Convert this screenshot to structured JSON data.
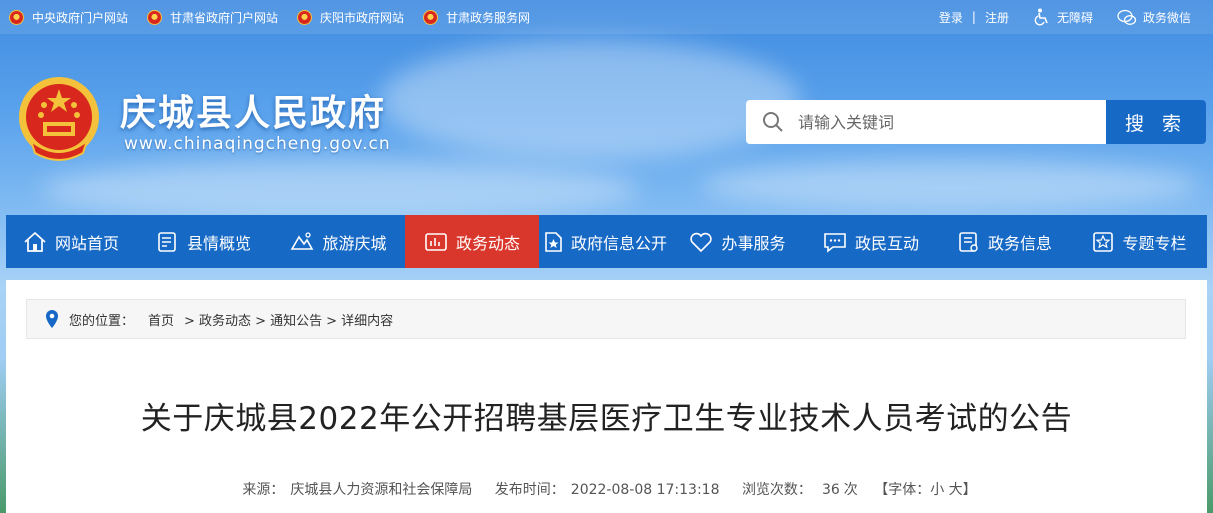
{
  "topbar": {
    "links": [
      {
        "label": "中央政府门户网站",
        "icon": "national-emblem-icon"
      },
      {
        "label": "甘肃省政府门户网站",
        "icon": "national-emblem-icon"
      },
      {
        "label": "庆阳市政府网站",
        "icon": "national-emblem-icon"
      },
      {
        "label": "甘肃政务服务网",
        "icon": "national-emblem-icon"
      }
    ],
    "login": "登录",
    "divider": "|",
    "register": "注册",
    "accessibility": "无障碍",
    "wechat": "政务微信"
  },
  "header": {
    "title": "庆城县人民政府",
    "url": "www.chinaqingcheng.gov.cn"
  },
  "search": {
    "placeholder": "请输入关键词",
    "button": "搜 索"
  },
  "nav": {
    "items": [
      {
        "label": "网站首页",
        "icon": "home-icon"
      },
      {
        "label": "县情概览",
        "icon": "document-icon"
      },
      {
        "label": "旅游庆城",
        "icon": "mountain-icon"
      },
      {
        "label": "政务动态",
        "icon": "chart-icon",
        "active": true
      },
      {
        "label": "政府信息公开",
        "icon": "star-doc-icon"
      },
      {
        "label": "办事服务",
        "icon": "heart-icon"
      },
      {
        "label": "政民互动",
        "icon": "chat-icon"
      },
      {
        "label": "政务信息",
        "icon": "list-icon"
      },
      {
        "label": "专题专栏",
        "icon": "star-icon"
      }
    ]
  },
  "breadcrumb": {
    "prefix": "您的位置：",
    "home": "首页",
    "level1": "> 政务动态",
    "level2": "> 通知公告",
    "level3": "> 详细内容"
  },
  "article": {
    "title": "关于庆城县2022年公开招聘基层医疗卫生专业技术人员考试的公告",
    "source_label": "来源：",
    "source": "庆城县人力资源和社会保障局",
    "time_label": "发布时间：",
    "time": "2022-08-08 17:13:18",
    "views_label": "浏览次数：",
    "views": "36",
    "views_unit": "次",
    "font_size": "【字体：小 大】"
  },
  "colors": {
    "nav_blue": "#1769c6",
    "nav_active": "#d9372b"
  }
}
